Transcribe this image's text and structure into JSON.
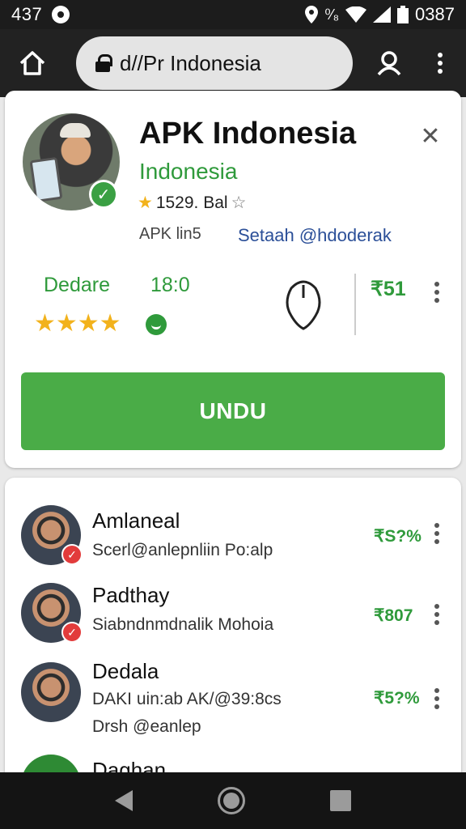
{
  "status_bar": {
    "time": "437",
    "battery_text": "0387",
    "signal_glyph": "⁰⁄₈"
  },
  "browser": {
    "url": "d//Pr Indonesia"
  },
  "profile": {
    "title": "APK Indonesia",
    "subtitle": "Indonesia",
    "rating_text": "1529. Bal",
    "meta_left": "APK lin5",
    "meta_link": "Setaah @hdoderak",
    "stat_label": "Dedare",
    "stat_value": "18:0",
    "stars": "★★★★",
    "price": "₹51",
    "download_label": "UNDU"
  },
  "list": {
    "items": [
      {
        "name": "Amlaneal",
        "line1": "Scerl@anlepnliin Po:alp",
        "line2": "",
        "price": "₹S?%"
      },
      {
        "name": "Padthay",
        "line1": "Siabndnmdnalik Mohoia",
        "line2": "",
        "price": "₹807"
      },
      {
        "name": "Dedala",
        "line1": "DAKI uin:ab AK/@39:8cs",
        "line2": "Drsh @eanlep",
        "price": "₹5?%"
      },
      {
        "name": "Daghan",
        "line1": "",
        "line2": "",
        "price": ""
      }
    ]
  },
  "colors": {
    "accent_green": "#4aac47",
    "text_green": "#2f9a3b",
    "link_blue": "#2b4f98",
    "star_gold": "#f2b21c"
  },
  "icons": [
    "notification-icon",
    "location-icon",
    "wifi-icon",
    "signal-icon",
    "battery-icon",
    "home-icon",
    "lock-icon",
    "account-icon",
    "more-vert-icon",
    "close-icon",
    "verified-icon",
    "star-icon",
    "chat-icon",
    "mouse-icon",
    "back-icon",
    "home-nav-icon",
    "recent-icon"
  ]
}
